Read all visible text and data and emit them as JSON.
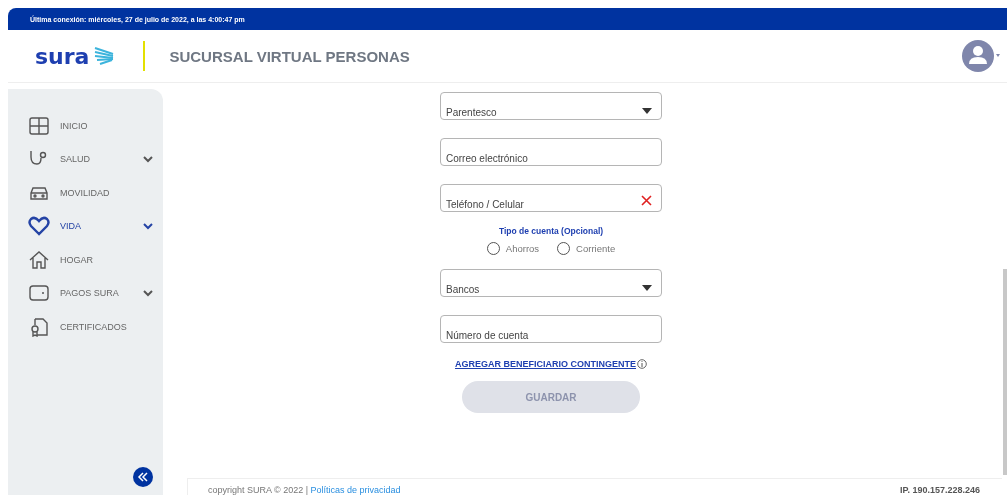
{
  "top_bar": {
    "last_login": "Última conexión: miércoles, 27 de julio de 2022, a las 4:00:47 pm"
  },
  "header": {
    "logo": "sura",
    "title": "SUCURSAL VIRTUAL PERSONAS"
  },
  "sidebar": {
    "items": [
      {
        "label": "INICIO",
        "expandable": false,
        "selected": false
      },
      {
        "label": "SALUD",
        "expandable": true,
        "selected": false
      },
      {
        "label": "MOVILIDAD",
        "expandable": false,
        "selected": false
      },
      {
        "label": "VIDA",
        "expandable": true,
        "selected": true
      },
      {
        "label": "HOGAR",
        "expandable": false,
        "selected": false
      },
      {
        "label": "PAGOS SURA",
        "expandable": true,
        "selected": false
      },
      {
        "label": "CERTIFICADOS",
        "expandable": false,
        "selected": false
      }
    ]
  },
  "form": {
    "fields_top": [
      {
        "kind": "select",
        "placeholder": "Parentesco"
      },
      {
        "kind": "text",
        "placeholder": "Correo electrónico"
      },
      {
        "kind": "error",
        "placeholder": "Teléfono / Celular"
      }
    ],
    "account_type": {
      "label": "Tipo de cuenta (Opcional)",
      "options": [
        {
          "label": "Ahorros",
          "selected": false
        },
        {
          "label": "Corriente",
          "selected": false
        }
      ]
    },
    "fields_bottom": [
      {
        "kind": "select",
        "placeholder": "Bancos"
      },
      {
        "kind": "text",
        "placeholder": "Número de cuenta"
      }
    ],
    "link": "AGREGAR BENEFICIARIO CONTINGENTE",
    "save_button": {
      "label": "GUARDAR",
      "disabled": true
    }
  },
  "footer": {
    "copyright": "copyright SURA © 2022 |",
    "privacy_link": "Políticas de privacidad",
    "ip": "IP. 190.157.228.246"
  }
}
